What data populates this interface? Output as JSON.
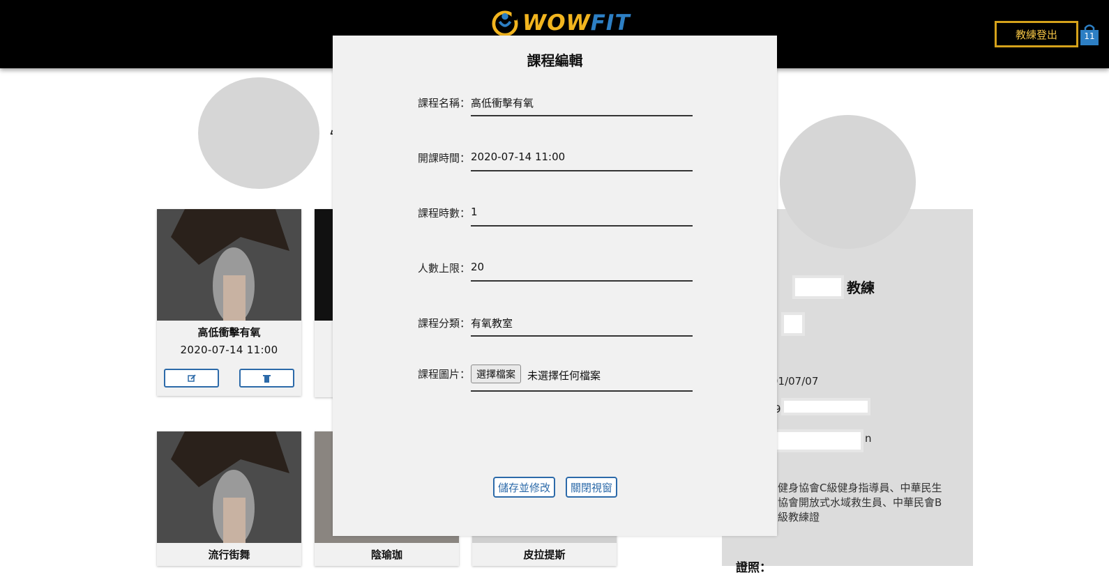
{
  "nav": {
    "logo_wow": "WOW",
    "logo_fit": "FIT",
    "logout_label": "教練登出",
    "cart_count": "11"
  },
  "courses": [
    {
      "title": "高低衝擊有氧",
      "date": "2020-07-14 11:00"
    },
    {
      "title": "流行街舞"
    },
    {
      "title": "陰瑜珈"
    },
    {
      "title": "皮拉提斯"
    }
  ],
  "profile": {
    "coach_label": "教練",
    "birthday_fragment": "91/07/07",
    "line_fragment_a": "9",
    "line_fragment_b": "n",
    "certificates": "健身協會C級健身指導員、中華民生協會開放式水域救生員、中華民會B級教練證",
    "cert_label": "證照："
  },
  "modal": {
    "title": "課程編輯",
    "fields": [
      {
        "label": "課程名稱：",
        "value": "高低衝擊有氧"
      },
      {
        "label": "開課時間：",
        "value": "2020-07-14 11:00"
      },
      {
        "label": "課程時數：",
        "value": "1"
      },
      {
        "label": "人數上限：",
        "value": "20"
      },
      {
        "label": "課程分類：",
        "value": "有氧教室"
      }
    ],
    "image_label": "課程圖片：",
    "file_button": "選擇檔案",
    "file_status": "未選擇任何檔案",
    "save_label": "儲存並修改",
    "close_label": "關閉視窗"
  }
}
